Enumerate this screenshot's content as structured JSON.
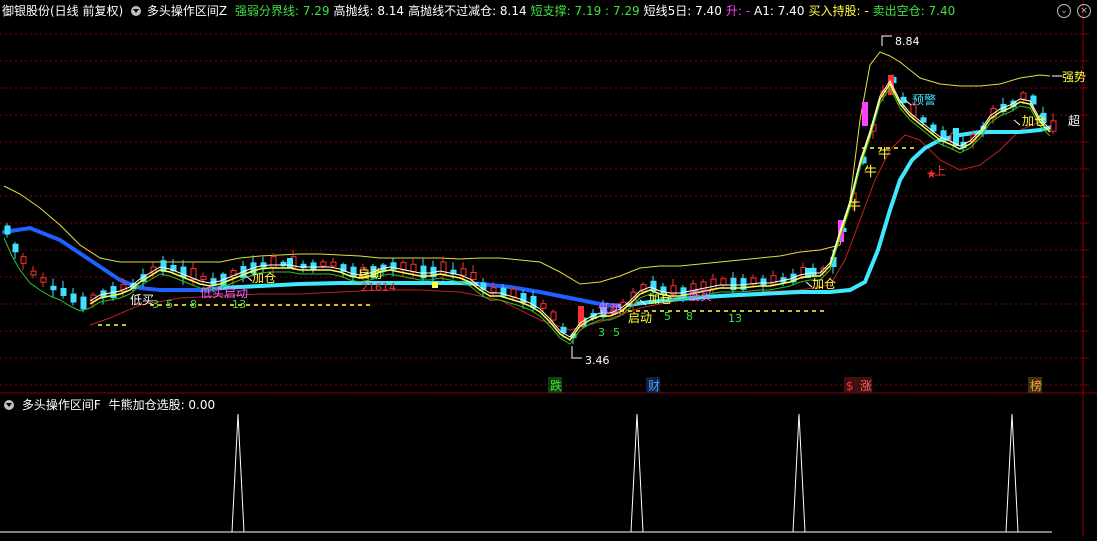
{
  "main_panel": {
    "stock_title": "御银股份(日线 前复权)",
    "indicator_name": "多头操作区间Z",
    "indicators": [
      {
        "label": "强弱分界线: ",
        "value": "7.29",
        "color": "#40e040"
      },
      {
        "label": "高抛线: ",
        "value": "8.14",
        "color": "#ffffff"
      },
      {
        "label": "高抛线不过减仓: ",
        "value": "8.14",
        "color": "#ffffff"
      },
      {
        "label": "短支撑: ",
        "value": "7.19 : 7.29",
        "color": "#40e040"
      },
      {
        "label": "短线5日: ",
        "value": "7.40",
        "color": "#ffffff"
      },
      {
        "label": "升: ",
        "value": "-",
        "color": "#ff40ff"
      },
      {
        "label": "A1: ",
        "value": "7.40",
        "color": "#ffffff"
      },
      {
        "label": "买入持股: ",
        "value": "-",
        "color": "#ffff40"
      },
      {
        "label": "卖出空仓: ",
        "value": "7.40",
        "color": "#40e040"
      }
    ],
    "high_label": "8.84",
    "low_label": "3.46",
    "right_tag_strong": "强势",
    "right_tag_super": "超",
    "annotations": [
      {
        "text": "加仓",
        "color": "#ffff40"
      },
      {
        "text": "低买",
        "color": "#ffffff"
      },
      {
        "text": "低买启动",
        "color": "#ff60ff"
      },
      {
        "text": "启动",
        "color": "#ffff40"
      },
      {
        "text": "21614",
        "color": "#ff3030"
      },
      {
        "text": "3",
        "color": "#40e040"
      },
      {
        "text": "5",
        "color": "#40e040"
      },
      {
        "text": "8",
        "color": "#40e040"
      },
      {
        "text": "13",
        "color": "#40e040"
      },
      {
        "text": "低买",
        "color": "#ff60ff"
      },
      {
        "text": "启动",
        "color": "#ffff40"
      },
      {
        "text": "加仓",
        "color": "#ffff40"
      },
      {
        "text": "低买",
        "color": "#ff60ff"
      },
      {
        "text": "3",
        "color": "#40e040"
      },
      {
        "text": "5",
        "color": "#40e040"
      },
      {
        "text": "5",
        "color": "#40e040"
      },
      {
        "text": "8",
        "color": "#40e040"
      },
      {
        "text": "13",
        "color": "#40e040"
      },
      {
        "text": "加仓",
        "color": "#ffff40"
      },
      {
        "text": "牛",
        "color": "#ffff40"
      },
      {
        "text": "牛",
        "color": "#ffff40"
      },
      {
        "text": "牛",
        "color": "#ffff40"
      },
      {
        "text": "预警",
        "color": "#40e0ff"
      },
      {
        "text": "上",
        "color": "#ff3030"
      },
      {
        "text": "加仓",
        "color": "#ffff40"
      }
    ],
    "bottom_tags": [
      {
        "text": "跌",
        "color": "#40e040",
        "bg": "#104010"
      },
      {
        "text": "财",
        "color": "#40a0ff",
        "bg": "#102040"
      },
      {
        "text": "$",
        "color": "#ff3030",
        "bg": "#401010"
      },
      {
        "text": "涨",
        "color": "#ff6060",
        "bg": "#401010"
      },
      {
        "text": "榜",
        "color": "#ffa040",
        "bg": "#403010"
      }
    ]
  },
  "sub_panel": {
    "indicator_name": "多头操作区间F",
    "value_label": "牛熊加仓选股: ",
    "value": "0.00"
  },
  "colors": {
    "grid": "#8b0000",
    "up": "#ff3030",
    "down": "#40e0ff",
    "ma_cyan": "#40e8ff",
    "ma_blue": "#2060ff",
    "upper_band": "#e0e040",
    "yellow": "#ffff40",
    "white": "#ffffff",
    "magenta": "#ff40ff",
    "green": "#40e040"
  }
}
